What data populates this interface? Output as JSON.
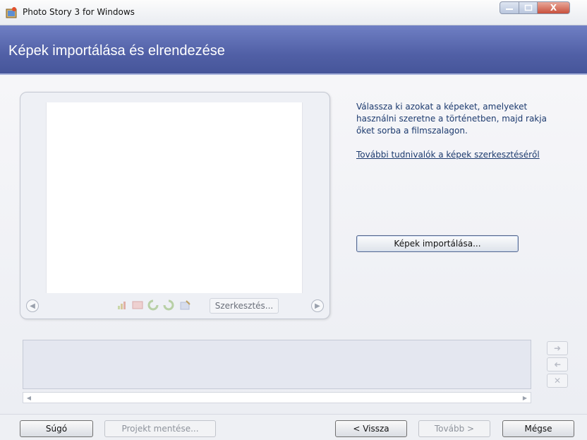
{
  "window": {
    "title": "Photo Story 3 for Windows",
    "close_glyph": "X"
  },
  "header": {
    "title": "Képek importálása és elrendezése"
  },
  "preview": {
    "edit_label": "Szerkesztés..."
  },
  "info": {
    "description": "Válassza ki azokat a képeket, amelyeket használni szeretne a történetben, majd rakja őket sorba a filmszalagon.",
    "link": "További tudnivalók a képek szerkesztéséről"
  },
  "import_button": "Képek importálása...",
  "footer": {
    "help": "Súgó",
    "save_project": "Projekt mentése...",
    "back": "< Vissza",
    "next": "Tovább >",
    "cancel": "Mégse"
  },
  "icons": {
    "app": "photo-story-app-icon",
    "move_right": "arrow-right-icon",
    "move_left": "arrow-left-icon",
    "delete": "delete-x-icon"
  }
}
